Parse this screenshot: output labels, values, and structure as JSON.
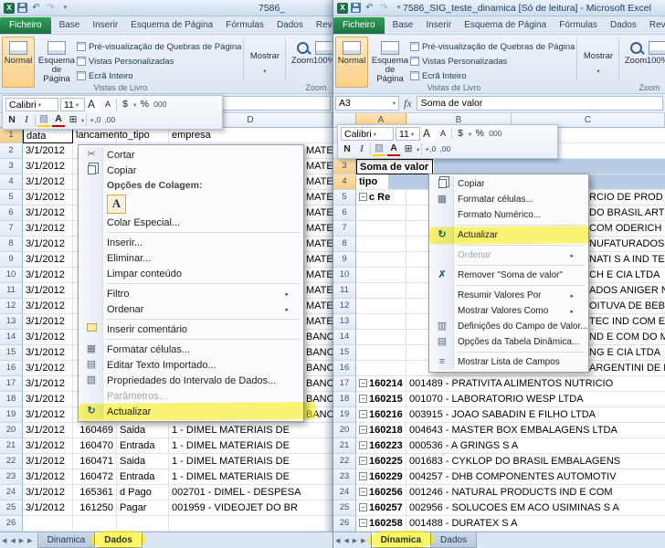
{
  "colors": {
    "annotation": "#ffee00",
    "selection": "#b8cce4",
    "file_tab_green": "#1e7145"
  },
  "glyphs": {
    "dropdown": "▾",
    "submenu": "▸",
    "collapse": "−"
  },
  "qat": {
    "undo": "↶",
    "redo": "↷"
  },
  "sheet_nav": [
    "◀",
    "◀",
    "▶",
    "▶"
  ],
  "fx_label": "fx",
  "ribbon_tabs": [
    "Ficheiro",
    "Base",
    "Inserir",
    "Esquema de Página",
    "Fórmulas",
    "Dados",
    "Rever"
  ],
  "ribbon": {
    "normal": "Normal",
    "page_layout_1": "Esquema",
    "page_layout_2": "de Página",
    "page_break_preview": "Pré-visualização de Quebras de Página",
    "custom_views": "Vistas Personalizadas",
    "full_screen": "Ecrã Inteiro",
    "show": "Mostrar",
    "views_group": "Vistas de Livro",
    "zoom": "Zoom",
    "zoom_100": "100%",
    "zoom_group": "Zoom"
  },
  "minibar": {
    "font": "Calibri",
    "size": "11",
    "grow": "A",
    "shrink": "A",
    "currency": "$",
    "percent": "%",
    "thousands": "000",
    "bold": "N",
    "italic": "I",
    "fill": "▨",
    "font_color": "A",
    "borders": "⊞",
    "inc_decimal": "+,0",
    "dec_decimal": ",00"
  },
  "left": {
    "title": "7586_",
    "fx": {
      "name": "",
      "value": ""
    },
    "menu": {
      "items": [
        {
          "t": "item",
          "label": "Cortar",
          "icon": "scissors",
          "glyph": "✂"
        },
        {
          "t": "item",
          "label": "Copiar",
          "icon": "copy"
        },
        {
          "t": "label",
          "label": "Opções de Colagem:"
        },
        {
          "t": "paste",
          "label": "A"
        },
        {
          "t": "item",
          "label": "Colar Especial..."
        },
        {
          "t": "sep"
        },
        {
          "t": "item",
          "label": "Inserir..."
        },
        {
          "t": "item",
          "label": "Eliminar..."
        },
        {
          "t": "item",
          "label": "Limpar conteúdo"
        },
        {
          "t": "sep"
        },
        {
          "t": "item",
          "label": "Filtro",
          "sub": true
        },
        {
          "t": "item",
          "label": "Ordenar",
          "sub": true
        },
        {
          "t": "sep"
        },
        {
          "t": "item",
          "label": "Inserir comentário",
          "icon": "comment"
        },
        {
          "t": "sep"
        },
        {
          "t": "item",
          "label": "Formatar células...",
          "icon": "format-cells",
          "glyph": "▦"
        },
        {
          "t": "item",
          "label": "Editar Texto Importado...",
          "icon": "edit-text",
          "glyph": "▤"
        },
        {
          "t": "item",
          "label": "Propriedades do Intervalo de Dados...",
          "icon": "properties",
          "glyph": "▧"
        },
        {
          "t": "item",
          "label": "Parâmetros...",
          "disabled": true
        },
        {
          "t": "item",
          "label": "Actualizar",
          "icon": "refresh",
          "glyph": "↻",
          "highlight": true
        }
      ]
    },
    "grid": {
      "col_letters": [
        "A",
        "B",
        "C",
        "D"
      ],
      "rows": [
        {
          "n": "1",
          "a": "data",
          "b": "lancamento_tipo",
          "d": "empresa",
          "hd": true,
          "active": true,
          "hot": true
        },
        {
          "n": "2",
          "a": "3/1/2012",
          "frag": "MATERIAIS DE"
        },
        {
          "n": "3",
          "a": "3/1/2012",
          "frag": "MATERIAIS DE"
        },
        {
          "n": "4",
          "a": "3/1/2012",
          "frag": "MATERIAIS DE"
        },
        {
          "n": "5",
          "a": "3/1/2012",
          "frag": "MATERIAIS DE"
        },
        {
          "n": "6",
          "a": "3/1/2012",
          "frag": "MATERIAIS DE"
        },
        {
          "n": "7",
          "a": "3/1/2012",
          "frag": "MATERIAIS DE"
        },
        {
          "n": "8",
          "a": "3/1/2012",
          "frag": "MATERIAIS DE"
        },
        {
          "n": "9",
          "a": "3/1/2012",
          "frag": "MATERIAIS DE"
        },
        {
          "n": "10",
          "a": "3/1/2012",
          "frag": "MATERIAIS DE"
        },
        {
          "n": "11",
          "a": "3/1/2012",
          "frag": "MATERIAIS DE"
        },
        {
          "n": "12",
          "a": "3/1/2012",
          "frag": "MATERIAIS DE"
        },
        {
          "n": "13",
          "a": "3/1/2012",
          "frag": "MATERIAIS DE"
        },
        {
          "n": "14",
          "a": "3/1/2012",
          "frag": "BANCO DO BRAS"
        },
        {
          "n": "15",
          "a": "3/1/2012",
          "frag": "BANCO DO BRAS"
        },
        {
          "n": "16",
          "a": "3/1/2012",
          "frag": "BANCO DO BRAS"
        },
        {
          "n": "17",
          "a": "3/1/2012",
          "frag": "BANCO SICREDI"
        },
        {
          "n": "18",
          "a": "3/1/2012",
          "frag": "BANCO SICREDI"
        },
        {
          "n": "19",
          "a": "3/1/2012",
          "frag": "BANCO BRADES"
        },
        {
          "n": "20",
          "a": "3/1/2012",
          "b": "160469",
          "c": "Saida",
          "d": "1 - DIMEL MATERIAIS DE"
        },
        {
          "n": "21",
          "a": "3/1/2012",
          "b": "160470",
          "c": "Entrada",
          "d": "1 - DIMEL MATERIAIS DE"
        },
        {
          "n": "22",
          "a": "3/1/2012",
          "b": "160471",
          "c": "Saida",
          "d": "1 - DIMEL MATERIAIS DE"
        },
        {
          "n": "23",
          "a": "3/1/2012",
          "b": "160472",
          "c": "Entrada",
          "d": "1 - DIMEL MATERIAIS DE"
        },
        {
          "n": "24",
          "a": "3/1/2012",
          "b": "165361",
          "c": "d Pago",
          "d": "002701 - DIMEL - DESPESA"
        },
        {
          "n": "25",
          "a": "3/1/2012",
          "b": "161250",
          "c": "Pagar",
          "d": "001959 - VIDEOJET DO BR"
        },
        {
          "n": "26"
        }
      ]
    },
    "sheet_tabs": [
      {
        "label": "Dinamica"
      },
      {
        "label": "Dados",
        "active": true,
        "highlighted": true
      }
    ]
  },
  "right": {
    "title": "7586_SIG_teste_dinamica  [Só de leitura] - Microsoft Excel",
    "fx": {
      "name": "A3",
      "value": "Soma de valor"
    },
    "menu": {
      "items": [
        {
          "t": "item",
          "label": "Copiar",
          "icon": "copy"
        },
        {
          "t": "item",
          "label": "Formatar células...",
          "icon": "format-cells",
          "glyph": "▦"
        },
        {
          "t": "item",
          "label": "Formato Numérico..."
        },
        {
          "t": "sep"
        },
        {
          "t": "item",
          "label": "Actualizar",
          "icon": "refresh",
          "glyph": "↻",
          "highlight": true
        },
        {
          "t": "sep"
        },
        {
          "t": "item",
          "label": "Ordenar",
          "sub": true,
          "disabled": true
        },
        {
          "t": "sep"
        },
        {
          "t": "item",
          "label": "Remover \"Soma de valor\"",
          "icon": "remove",
          "glyph": "✗"
        },
        {
          "t": "sep"
        },
        {
          "t": "item",
          "label": "Resumir Valores Por",
          "sub": true
        },
        {
          "t": "item",
          "label": "Mostrar Valores Como",
          "sub": true
        },
        {
          "t": "item",
          "label": "Definições do Campo de Valor...",
          "icon": "field-settings",
          "glyph": "▥"
        },
        {
          "t": "item",
          "label": "Opções da Tabela Dinâmica...",
          "icon": "pivot-options",
          "glyph": "▤"
        },
        {
          "t": "sep"
        },
        {
          "t": "item",
          "label": "Mostrar Lista de Campos",
          "icon": "field-list",
          "glyph": "≡"
        }
      ]
    },
    "grid": {
      "col_letters": [
        "A",
        "B",
        "C"
      ],
      "rows": [
        {
          "n": "1"
        },
        {
          "n": "2"
        },
        {
          "n": "3",
          "a": "Soma de valor",
          "bold": true,
          "active": true,
          "band": "b3",
          "hot": true
        },
        {
          "n": "4",
          "a": "tipo",
          "bold": true,
          "band": "b4",
          "hot": true
        },
        {
          "n": "5",
          "a": "c Re",
          "box": true,
          "bold": true,
          "frag": "RCIO DE PROD DE BELEZA E"
        },
        {
          "n": "6",
          "frag": "DO BRASIL ARTEF DE CO"
        },
        {
          "n": "7",
          "frag": "COM ODERICH LTDA"
        },
        {
          "n": "8",
          "frag": "NUFATURADOS LTDA"
        },
        {
          "n": "9",
          "frag": "NATI S A IND TEXTIL"
        },
        {
          "n": "10",
          "frag": "CH E CIA LTDA"
        },
        {
          "n": "11",
          "frag": "ADOS ANIGER NORDESTE LT"
        },
        {
          "n": "12",
          "frag": "OITUVA DE BEBIDAS S/A"
        },
        {
          "n": "13",
          "frag": "TEC IND COM E SERVS LTDA"
        },
        {
          "n": "14",
          "frag": "ND E COM DO MATE LTDA"
        },
        {
          "n": "15",
          "frag": "NG E CIA LTDA"
        },
        {
          "n": "16",
          "frag": "ARGENTINI DE BEBIDAS E ALI"
        },
        {
          "n": "17",
          "a": "160214",
          "box": true,
          "bold": true,
          "b": "001489 - PRATIVITA ALIMENTOS NUTRICIO"
        },
        {
          "n": "18",
          "a": "160215",
          "box": true,
          "bold": true,
          "b": "001070 - LABORATORIO WESP LTDA"
        },
        {
          "n": "19",
          "a": "160216",
          "box": true,
          "bold": true,
          "b": "003915 - JOAO SABADIN E FILHO LTDA"
        },
        {
          "n": "20",
          "a": "160218",
          "box": true,
          "bold": true,
          "b": "004643 - MASTER BOX EMBALAGENS LTDA"
        },
        {
          "n": "21",
          "a": "160223",
          "box": true,
          "bold": true,
          "b": "000536 - A GRINGS S A"
        },
        {
          "n": "22",
          "a": "160225",
          "box": true,
          "bold": true,
          "b": "001683 - CYKLOP DO BRASIL EMBALAGENS"
        },
        {
          "n": "23",
          "a": "160229",
          "box": true,
          "bold": true,
          "b": "004257 - DHB COMPONENTES AUTOMOTIV"
        },
        {
          "n": "24",
          "a": "160256",
          "box": true,
          "bold": true,
          "b": "001246 - NATURAL PRODUCTS IND E COM"
        },
        {
          "n": "25",
          "a": "160257",
          "box": true,
          "bold": true,
          "b": "002956 - SOLUCOES EM ACO USIMINAS S A"
        },
        {
          "n": "26",
          "a": "160258",
          "box": true,
          "bold": true,
          "b": "001488 - DURATEX S A"
        }
      ]
    },
    "sheet_tabs": [
      {
        "label": "Dinamica",
        "active": true,
        "highlighted": true
      },
      {
        "label": "Dados"
      }
    ]
  }
}
